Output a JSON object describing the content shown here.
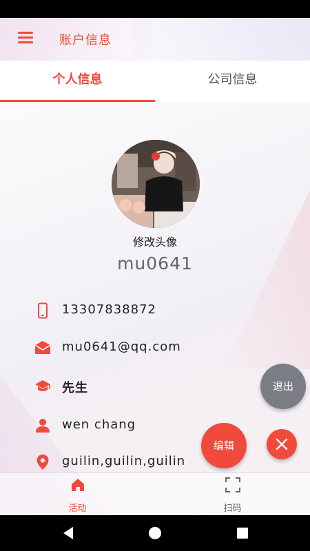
{
  "appbar": {
    "title": "账户信息",
    "menu_icon": "menu-icon"
  },
  "tabs": [
    {
      "label": "个人信息",
      "active": true
    },
    {
      "label": "公司信息",
      "active": false
    }
  ],
  "profile": {
    "avatar_label": "修改头像",
    "username": "mu0641"
  },
  "info": {
    "phone": {
      "icon": "phone-icon",
      "value": "13307838872"
    },
    "email": {
      "icon": "email-icon",
      "value": "mu0641@qq.com"
    },
    "title": {
      "icon": "graduation-cap-icon",
      "value": "先生"
    },
    "name": {
      "icon": "person-icon",
      "value": "wen chang"
    },
    "location": {
      "icon": "location-icon",
      "value": "guilin,guilin,guilin"
    }
  },
  "actions": {
    "logout_label": "退出",
    "edit_label": "编辑",
    "close_icon": "close-icon"
  },
  "bottom_nav": [
    {
      "label": "活动",
      "icon": "home-icon",
      "active": true
    },
    {
      "label": "扫码",
      "icon": "scan-icon",
      "active": false
    }
  ],
  "colors": {
    "accent": "#f04a3c",
    "logout_button": "#7b7d85",
    "text": "#222222"
  }
}
